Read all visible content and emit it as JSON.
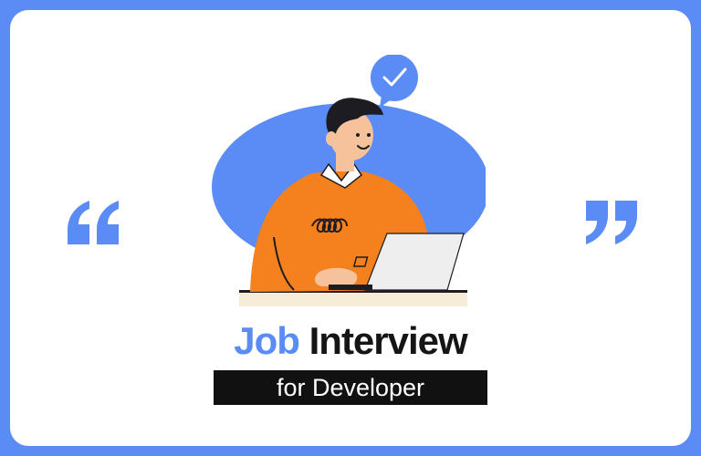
{
  "colors": {
    "frame": "#5b8cf5",
    "card": "#ffffff",
    "accent_blue": "#5b8cf5",
    "sweater_orange": "#f5801e",
    "hair": "#1c1c22",
    "skin": "#f5c29c",
    "laptop": "#eeeeee",
    "desk": "#f7ecd7",
    "subtitle_bg": "#111111"
  },
  "icons": {
    "open_quote": "left-double-quote-icon",
    "close_quote": "right-double-quote-icon",
    "speech_bubble": "check-speech-bubble-icon"
  },
  "title": {
    "word1": "Job",
    "word2": "Interview"
  },
  "subtitle": "for Developer"
}
